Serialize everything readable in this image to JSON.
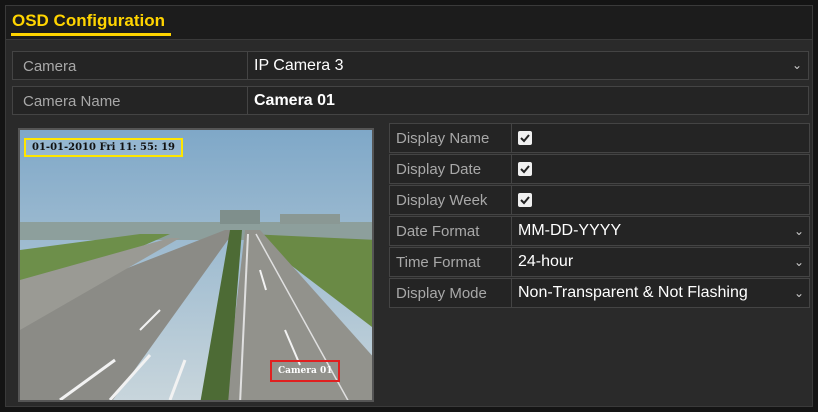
{
  "window": {
    "title": "OSD Configuration"
  },
  "camera": {
    "label": "Camera",
    "value": "IP Camera 3"
  },
  "camera_name": {
    "label": "Camera Name",
    "value": "Camera 01"
  },
  "preview": {
    "date_overlay": "01-01-2010  Fri  11: 55: 19",
    "name_overlay": "Camera 01"
  },
  "settings": {
    "display_name": {
      "label": "Display Name",
      "checked": true
    },
    "display_date": {
      "label": "Display Date",
      "checked": true
    },
    "display_week": {
      "label": "Display Week",
      "checked": true
    },
    "date_format": {
      "label": "Date Format",
      "value": "MM-DD-YYYY"
    },
    "time_format": {
      "label": "Time Format",
      "value": "24-hour"
    },
    "display_mode": {
      "label": "Display Mode",
      "value": "Non-Transparent & Not Flashing"
    }
  },
  "icons": {
    "dropdown": "chevron-down-icon",
    "checkbox": "checkbox-checked-icon"
  },
  "colors": {
    "title": "#ffd400",
    "date_box": "#ffe600",
    "name_box": "#e02020",
    "background": "#2a2a2a"
  }
}
